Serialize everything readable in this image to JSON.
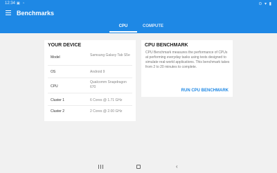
{
  "status_bar": {
    "time": "12:34",
    "icons_left": "▣ ◔",
    "icons_right": "⊙ ▾ ▮"
  },
  "app_bar": {
    "title": "Benchmarks",
    "tabs": [
      {
        "label": "CPU",
        "selected": true
      },
      {
        "label": "COMPUTE",
        "selected": false
      }
    ],
    "accent_color": "#1e88e5"
  },
  "device_card": {
    "title": "YOUR DEVICE",
    "specs": [
      {
        "label": "Model",
        "value": "Samsung Galaxy Tab S5e"
      },
      {
        "label": "OS",
        "value": "Android 9"
      },
      {
        "label": "CPU",
        "value": "Qualcomm Snapdragon 670"
      },
      {
        "label": "Cluster 1",
        "value": "6 Cores @ 1.71 GHz"
      },
      {
        "label": "Cluster 2",
        "value": "2 Cores @ 2.00 GHz"
      }
    ]
  },
  "benchmark_card": {
    "title": "CPU BENCHMARK",
    "description": "CPU Benchmark measures the performance of CPUs at performing everyday tasks using tests designed to simulate real-world applications. This benchmark takes from 2 to 20 minutes to complete.",
    "run_label": "RUN CPU BENCHMARK"
  },
  "nav_bar": {
    "recent_icon": "recent-apps-icon",
    "home_icon": "home-icon",
    "back_icon": "back-icon"
  }
}
